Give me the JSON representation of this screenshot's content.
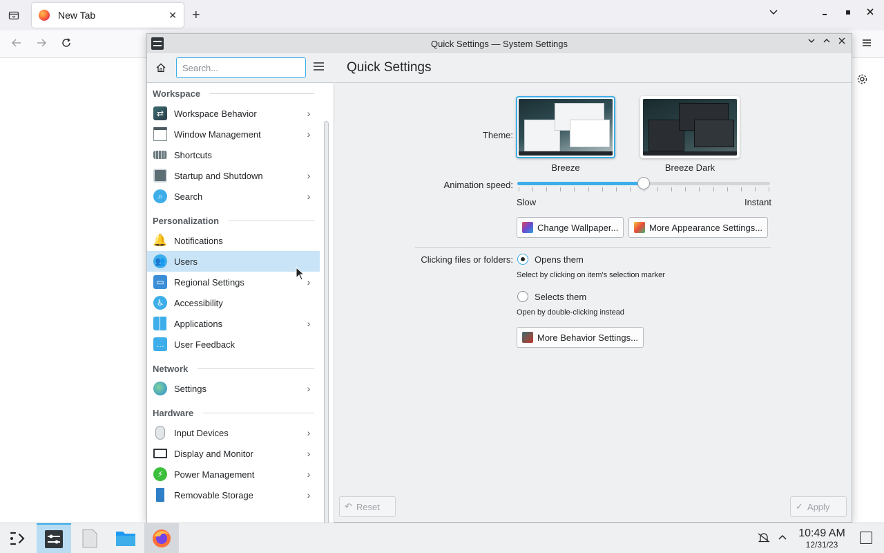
{
  "browser": {
    "tab_title": "New Tab",
    "new_tab": "+",
    "close_tab": "✕"
  },
  "window": {
    "title": "Quick Settings — System Settings"
  },
  "sidebar": {
    "search_placeholder": "Search...",
    "categories": {
      "workspace": "Workspace",
      "personalization": "Personalization",
      "network": "Network",
      "hardware": "Hardware"
    },
    "items": {
      "workspace_behavior": "Workspace Behavior",
      "window_management": "Window Management",
      "shortcuts": "Shortcuts",
      "startup_shutdown": "Startup and Shutdown",
      "search": "Search",
      "notifications": "Notifications",
      "users": "Users",
      "regional_settings": "Regional Settings",
      "accessibility": "Accessibility",
      "applications": "Applications",
      "user_feedback": "User Feedback",
      "settings": "Settings",
      "input_devices": "Input Devices",
      "display_monitor": "Display and Monitor",
      "power_management": "Power Management",
      "removable_storage": "Removable Storage"
    }
  },
  "main": {
    "title": "Quick Settings",
    "theme_label": "Theme:",
    "themes": [
      "Breeze",
      "Breeze Dark"
    ],
    "selected_theme": "Breeze",
    "animation_label": "Animation speed:",
    "animation_speed": 0.5,
    "slow_label": "Slow",
    "instant_label": "Instant",
    "change_wallpaper": "Change Wallpaper...",
    "more_appearance": "More Appearance Settings...",
    "clicking_label": "Clicking files or folders:",
    "opens_them": "Opens them",
    "opens_hint": "Select by clicking on item's selection marker",
    "selects_them": "Selects them",
    "selects_hint": "Open by double-clicking instead",
    "more_behavior": "More Behavior Settings...",
    "reset": "Reset",
    "apply": "Apply"
  },
  "taskbar": {
    "time": "10:49 AM",
    "date": "12/31/23"
  },
  "colors": {
    "accent": "#3daee9",
    "selection": "#c9e4f6"
  }
}
